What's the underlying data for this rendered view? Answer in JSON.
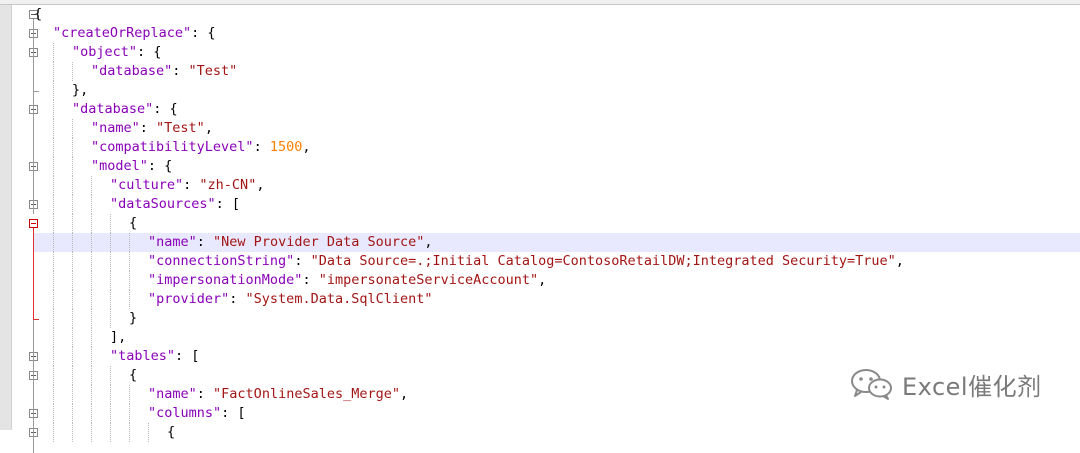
{
  "editor": {
    "lines": [
      [
        [
          "p",
          "{"
        ]
      ],
      [
        [
          "k",
          "\"createOrReplace\""
        ],
        [
          "p",
          ": {"
        ]
      ],
      [
        [
          "k",
          "\"object\""
        ],
        [
          "p",
          ": {"
        ]
      ],
      [
        [
          "k",
          "\"database\""
        ],
        [
          "p",
          ": "
        ],
        [
          "s",
          "\"Test\""
        ]
      ],
      [
        [
          "p",
          "},"
        ]
      ],
      [
        [
          "k",
          "\"database\""
        ],
        [
          "p",
          ": {"
        ]
      ],
      [
        [
          "k",
          "\"name\""
        ],
        [
          "p",
          ": "
        ],
        [
          "s",
          "\"Test\""
        ],
        [
          "p",
          ","
        ]
      ],
      [
        [
          "k",
          "\"compatibilityLevel\""
        ],
        [
          "p",
          ": "
        ],
        [
          "n",
          "1500"
        ],
        [
          "p",
          ","
        ]
      ],
      [
        [
          "k",
          "\"model\""
        ],
        [
          "p",
          ": {"
        ]
      ],
      [
        [
          "k",
          "\"culture\""
        ],
        [
          "p",
          ": "
        ],
        [
          "s",
          "\"zh-CN\""
        ],
        [
          "p",
          ","
        ]
      ],
      [
        [
          "k",
          "\"dataSources\""
        ],
        [
          "p",
          ": ["
        ]
      ],
      [
        [
          "p",
          "{"
        ]
      ],
      [
        [
          "k",
          "\"name\""
        ],
        [
          "p",
          ": "
        ],
        [
          "s",
          "\"New Provider Data Source\""
        ],
        [
          "p",
          ","
        ]
      ],
      [
        [
          "k",
          "\"connectionString\""
        ],
        [
          "p",
          ": "
        ],
        [
          "s",
          "\"Data Source=.;Initial Catalog=ContosoRetailDW;Integrated Security=True\""
        ],
        [
          "p",
          ","
        ]
      ],
      [
        [
          "k",
          "\"impersonationMode\""
        ],
        [
          "p",
          ": "
        ],
        [
          "s",
          "\"impersonateServiceAccount\""
        ],
        [
          "p",
          ","
        ]
      ],
      [
        [
          "k",
          "\"provider\""
        ],
        [
          "p",
          ": "
        ],
        [
          "s",
          "\"System.Data.SqlClient\""
        ]
      ],
      [
        [
          "p",
          "}"
        ]
      ],
      [
        [
          "p",
          "],"
        ]
      ],
      [
        [
          "k",
          "\"tables\""
        ],
        [
          "p",
          ": ["
        ]
      ],
      [
        [
          "p",
          "{"
        ]
      ],
      [
        [
          "k",
          "\"name\""
        ],
        [
          "p",
          ": "
        ],
        [
          "s",
          "\"FactOnlineSales_Merge\""
        ],
        [
          "p",
          ","
        ]
      ],
      [
        [
          "k",
          "\"columns\""
        ],
        [
          "p",
          ": ["
        ]
      ],
      [
        [
          "p",
          "{"
        ]
      ]
    ],
    "indent": [
      0,
      1,
      2,
      3,
      2,
      2,
      3,
      3,
      3,
      4,
      4,
      5,
      6,
      6,
      6,
      6,
      5,
      4,
      4,
      5,
      6,
      6,
      7
    ],
    "current_line": 12,
    "colors": {
      "key": "#8a00b8",
      "string": "#a31515",
      "number": "#ff8000",
      "punctuation": "#000000",
      "current_line_bg": "#e8e8ff",
      "active_fold": "#e03030"
    }
  },
  "watermark": {
    "icon": "wechat-icon",
    "text": "Excel催化剂"
  }
}
